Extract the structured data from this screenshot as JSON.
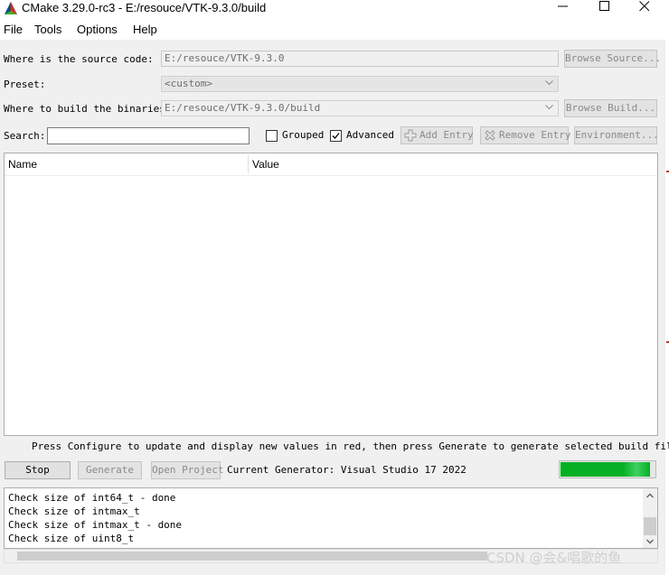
{
  "window": {
    "title": "CMake 3.29.0-rc3 - E:/resouce/VTK-9.3.0/build"
  },
  "menu": [
    "File",
    "Tools",
    "Options",
    "Help"
  ],
  "source": {
    "label": "Where is the source code:",
    "value": "E:/resouce/VTK-9.3.0",
    "browse_label": "Browse Source..."
  },
  "preset": {
    "label": "Preset:",
    "value": "<custom>"
  },
  "build": {
    "label": "Where to build the binaries:",
    "value": "E:/resouce/VTK-9.3.0/build",
    "browse_label": "Browse Build..."
  },
  "search": {
    "label": "Search:",
    "value": ""
  },
  "options": {
    "grouped_label": "Grouped",
    "grouped_checked": false,
    "advanced_label": "Advanced",
    "advanced_checked": true
  },
  "entry_buttons": {
    "add": "Add Entry",
    "remove": "Remove Entry",
    "environment": "Environment..."
  },
  "table": {
    "columns": [
      "Name",
      "Value"
    ],
    "rows": []
  },
  "hint": "Press Configure to update and display new values in red, then press Generate to generate selected build files.",
  "actions": {
    "stop": "Stop",
    "generate": "Generate",
    "open_project": "Open Project",
    "generator": "Current Generator: Visual Studio 17 2022"
  },
  "progress": {
    "value": 0.95
  },
  "log": [
    "Check size of int64_t - done",
    "Check size of intmax_t",
    "Check size of intmax_t - done",
    "Check size of uint8_t"
  ],
  "watermark": "CSDN @会&唱歌的鱼",
  "colors": {
    "progress": "#06b025",
    "accent": "#0078d7"
  }
}
